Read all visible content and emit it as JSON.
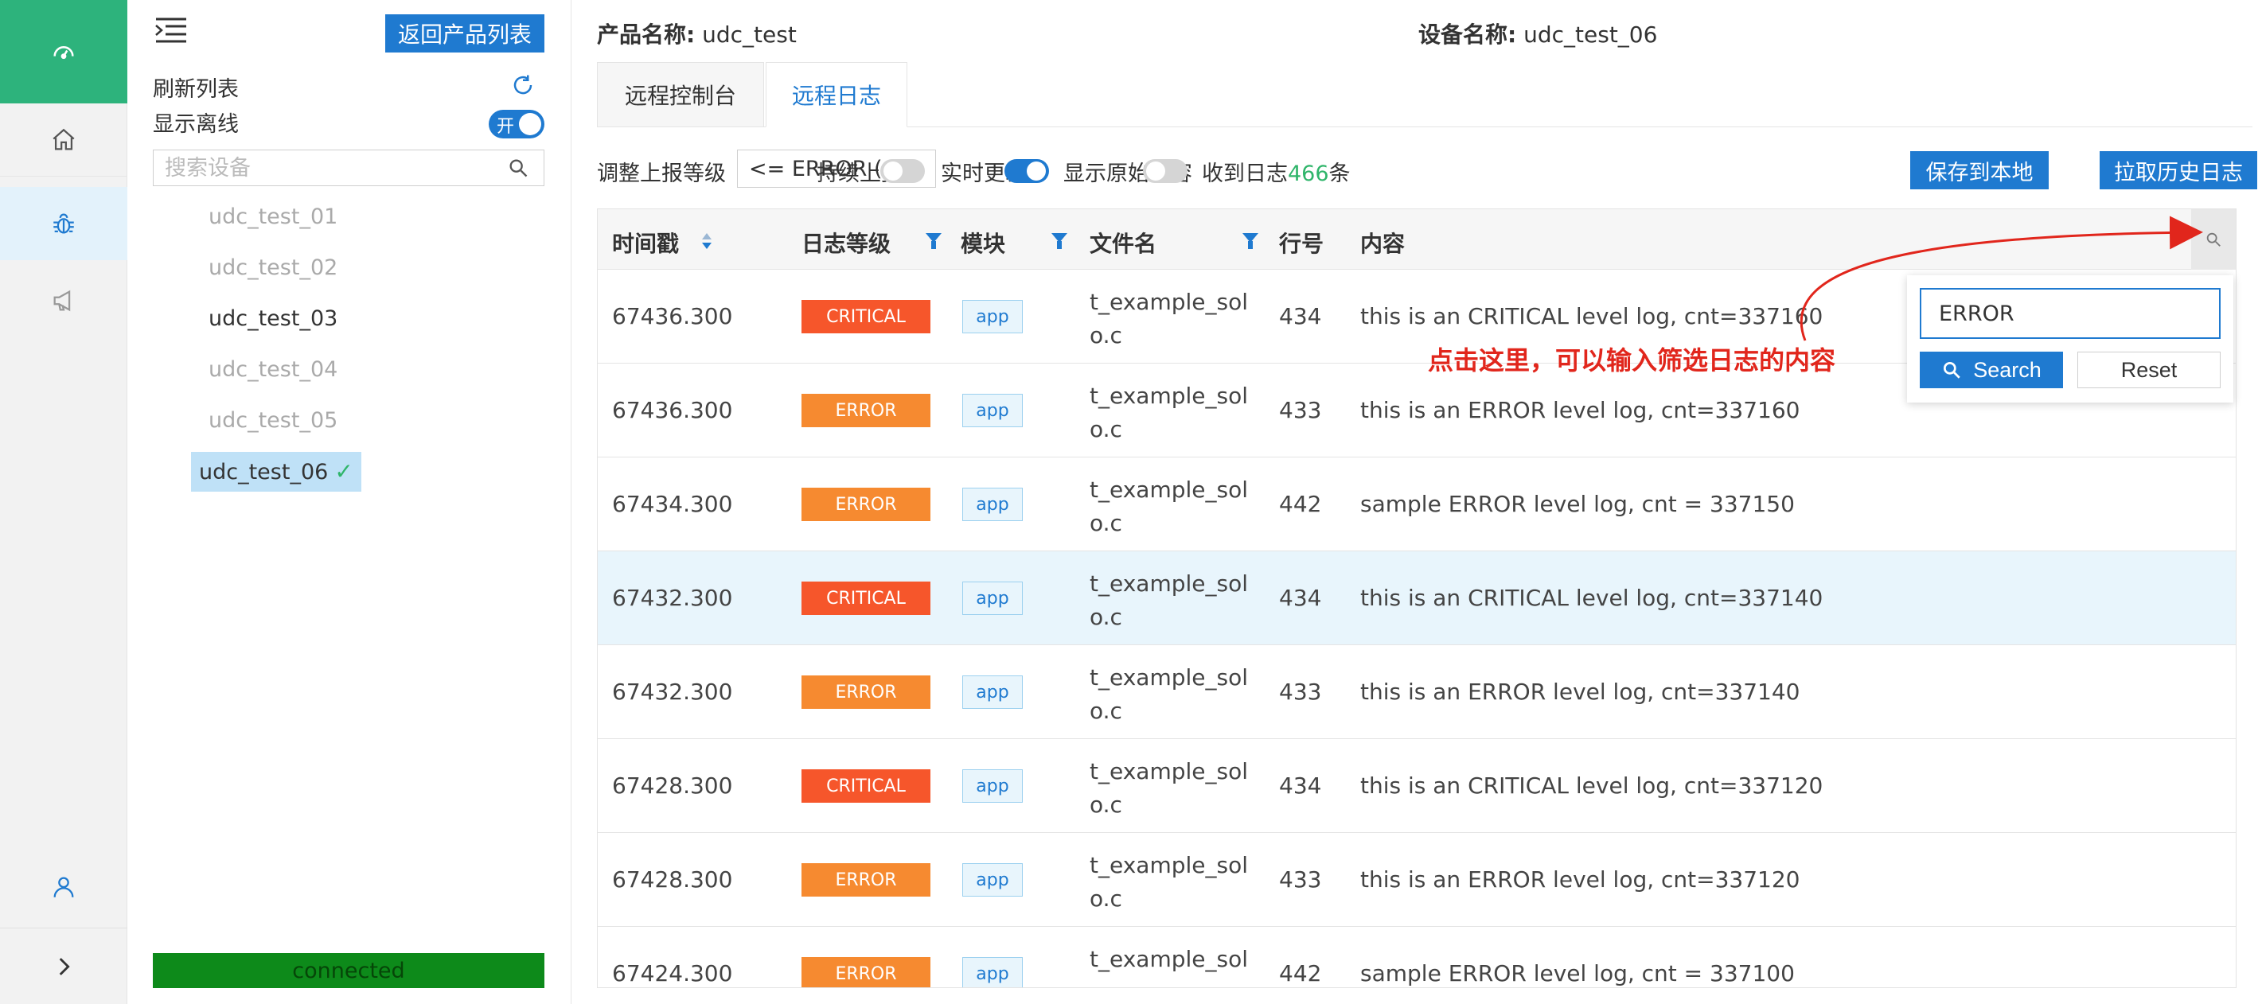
{
  "rail": {
    "items": [
      "dashboard-icon",
      "home-icon",
      "bug-icon",
      "speaker-icon",
      "user-icon",
      "chevron-right-icon"
    ],
    "accent": "#2db37c"
  },
  "panel": {
    "back_label": "返回产品列表",
    "refresh_label": "刷新列表",
    "offline_label": "显示离线",
    "offline_toggle_text": "开",
    "search_placeholder": "搜索设备",
    "devices": [
      {
        "name": "udc_test_01",
        "state": "offline"
      },
      {
        "name": "udc_test_02",
        "state": "offline"
      },
      {
        "name": "udc_test_03",
        "state": "online"
      },
      {
        "name": "udc_test_04",
        "state": "offline"
      },
      {
        "name": "udc_test_05",
        "state": "offline"
      },
      {
        "name": "udc_test_06",
        "state": "selected"
      }
    ],
    "check_mark": "✓",
    "status": "connected"
  },
  "main": {
    "product_label": "产品名称:",
    "product_value": "udc_test",
    "device_label": "设备名称:",
    "device_value": "udc_test_06",
    "tabs": [
      {
        "label": "远程控制台",
        "active": false
      },
      {
        "label": "远程日志",
        "active": true
      }
    ],
    "toolbar": {
      "level_label": "调整上报等级",
      "level_value": "<= ERROR (4)",
      "continuous_label": "持续上报",
      "realtime_label": "实时更新",
      "raw_label": "显示原始内容",
      "count_prefix": "收到日志",
      "count_value": "466",
      "count_suffix": "条",
      "save_label": "保存到本地",
      "pull_label": "拉取历史日志",
      "continuous_on": false,
      "realtime_on": true,
      "raw_on": false
    },
    "table": {
      "headers": [
        "时间戳",
        "日志等级",
        "模块",
        "文件名",
        "行号",
        "内容"
      ],
      "rows": [
        {
          "ts": "67436.300",
          "level": "CRITICAL",
          "module": "app",
          "file": "t_example_solo.c",
          "line": "434",
          "content": "this is an CRITICAL level log, cnt=337160",
          "highlight": false
        },
        {
          "ts": "67436.300",
          "level": "ERROR",
          "module": "app",
          "file": "t_example_solo.c",
          "line": "433",
          "content": "this is an ERROR level log, cnt=337160",
          "highlight": false
        },
        {
          "ts": "67434.300",
          "level": "ERROR",
          "module": "app",
          "file": "t_example_solo.c",
          "line": "442",
          "content": "sample ERROR level log, cnt = 337150",
          "highlight": false
        },
        {
          "ts": "67432.300",
          "level": "CRITICAL",
          "module": "app",
          "file": "t_example_solo.c",
          "line": "434",
          "content": "this is an CRITICAL level log, cnt=337140",
          "highlight": true
        },
        {
          "ts": "67432.300",
          "level": "ERROR",
          "module": "app",
          "file": "t_example_solo.c",
          "line": "433",
          "content": "this is an ERROR level log, cnt=337140",
          "highlight": false
        },
        {
          "ts": "67428.300",
          "level": "CRITICAL",
          "module": "app",
          "file": "t_example_solo.c",
          "line": "434",
          "content": "this is an CRITICAL level log, cnt=337120",
          "highlight": false
        },
        {
          "ts": "67428.300",
          "level": "ERROR",
          "module": "app",
          "file": "t_example_solo.c",
          "line": "433",
          "content": "this is an ERROR level log, cnt=337120",
          "highlight": false
        },
        {
          "ts": "67424.300",
          "level": "ERROR",
          "module": "app",
          "file": "t_example_solo.c",
          "line": "442",
          "content": "sample ERROR level log, cnt = 337100",
          "highlight": false
        }
      ]
    },
    "popup": {
      "input_value": "ERROR",
      "search_label": "Search",
      "reset_label": "Reset"
    },
    "annotation": "点击这里，可以输入筛选日志的内容"
  },
  "colors": {
    "primary": "#1f7ad0",
    "critical": "#f6562b",
    "error": "#f68a30",
    "connected": "#0d8a1a",
    "annotation": "#e1261c"
  }
}
